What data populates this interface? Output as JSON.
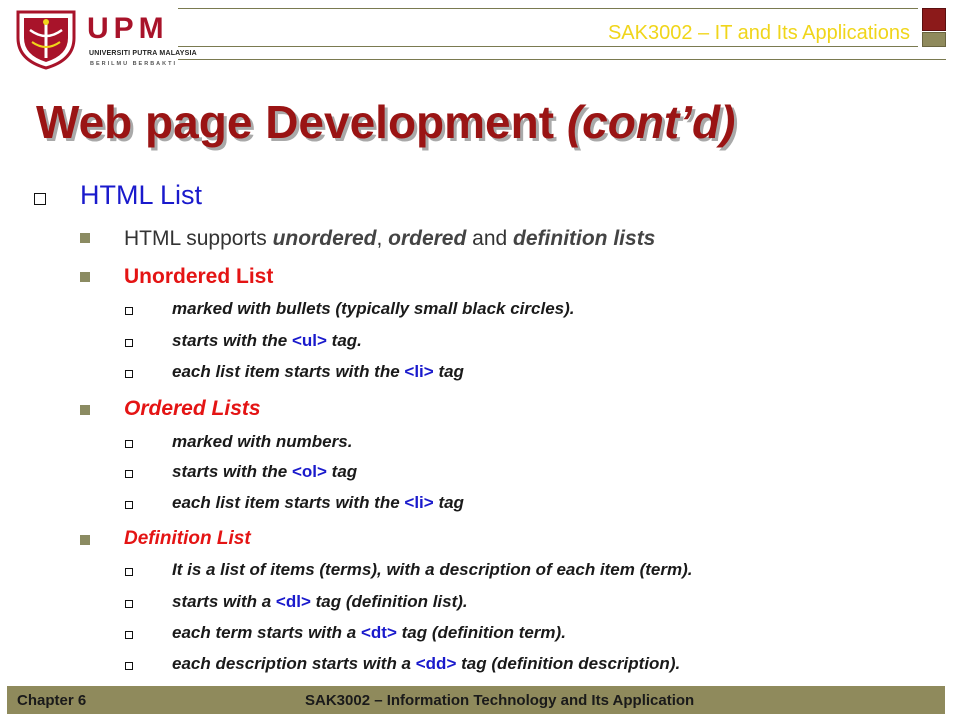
{
  "header": {
    "logo": {
      "acronym": "UPM",
      "university": "UNIVERSITI PUTRA MALAYSIA",
      "motto": "BERILMU BERBAKTI"
    },
    "course_title": "SAK3002 – IT and Its Applications"
  },
  "title": {
    "main": "Web page Development",
    "suffix": "(cont’d)"
  },
  "section": {
    "heading": "HTML List"
  },
  "intro": {
    "prefix": "HTML supports ",
    "term1": "unordered",
    "sep1": ", ",
    "term2": "ordered",
    "sep2": " and ",
    "term3": "definition lists"
  },
  "unordered": {
    "heading": "Unordered List",
    "item1": "marked with bullets (typically small black circles).",
    "item2_pre": "starts with the ",
    "item2_tag": "<ul>",
    "item2_post": " tag.",
    "item3_pre": "each list item starts with the ",
    "item3_tag": "<li>",
    "item3_post": " tag"
  },
  "ordered": {
    "heading": "Ordered Lists",
    "item1": "marked with numbers.",
    "item2_pre": "starts with the ",
    "item2_tag": "<ol>",
    "item2_post": " tag",
    "item3_pre": "each list item starts with the ",
    "item3_tag": "<li>",
    "item3_post": " tag"
  },
  "definition": {
    "heading": "Definition List",
    "item1": "It is a list of items (terms), with a description of each item (term).",
    "item2_pre": "starts with a ",
    "item2_tag": "<dl>",
    "item2_post": " tag (definition list).",
    "item3_pre": "each term starts with a ",
    "item3_tag": "<dt>",
    "item3_post": " tag (definition term).",
    "item4_pre": "each description starts with a ",
    "item4_tag": "<dd>",
    "item4_post": " tag (definition description)."
  },
  "footer": {
    "chapter": "Chapter 6",
    "course": "SAK3002 – Information Technology and Its Application"
  },
  "colors": {
    "title": "#9a1414",
    "heading_blue": "#1a1acc",
    "accent_red": "#e41414",
    "olive": "#8f8a5c",
    "header_yellow": "#f0d51a"
  }
}
